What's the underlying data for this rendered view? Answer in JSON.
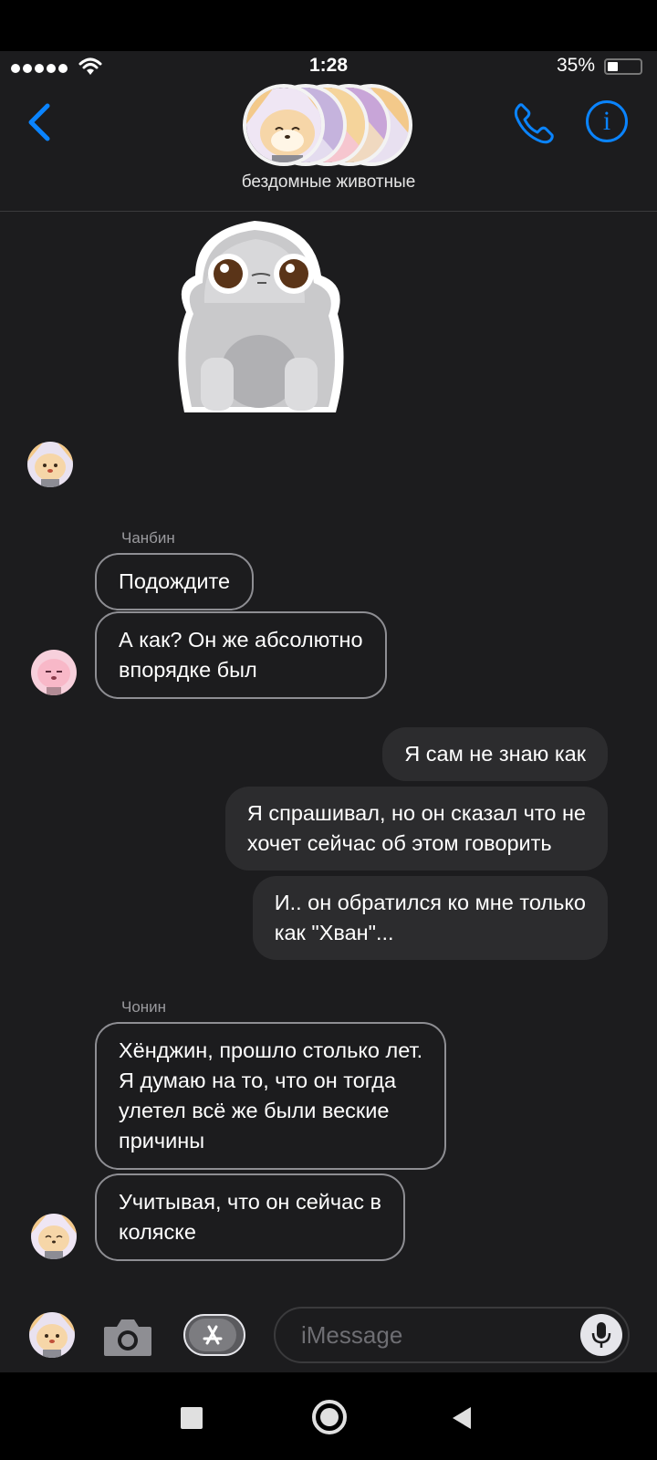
{
  "status_bar": {
    "time": "1:28",
    "battery": "35%"
  },
  "header": {
    "group_name": "бездомные животные"
  },
  "messages": [
    {
      "sender": "Чанбин",
      "text": "Подождите"
    },
    {
      "text": "А как? Он же абсолютно\nвпорядке был"
    },
    {
      "text": "Я сам не знаю как"
    },
    {
      "text": "Я спрашивал, но он сказал что не\nхочет сейчас об этом говорить"
    },
    {
      "text": "И.. он обратился ко мне только\nкак \"Хван\"..."
    },
    {
      "sender": "Чонин",
      "text": "Хёнджин, прошло столько лет.\nЯ думаю на то, что он тогда\nулетел всё же были веские\nпричины"
    },
    {
      "text": "Учитывая, что он сейчас в\nколяске"
    }
  ],
  "input": {
    "placeholder": "iMessage"
  },
  "colors": {
    "accent": "#0a84ff",
    "background": "#1c1c1e",
    "sent_bubble": "#2c2c2e"
  }
}
